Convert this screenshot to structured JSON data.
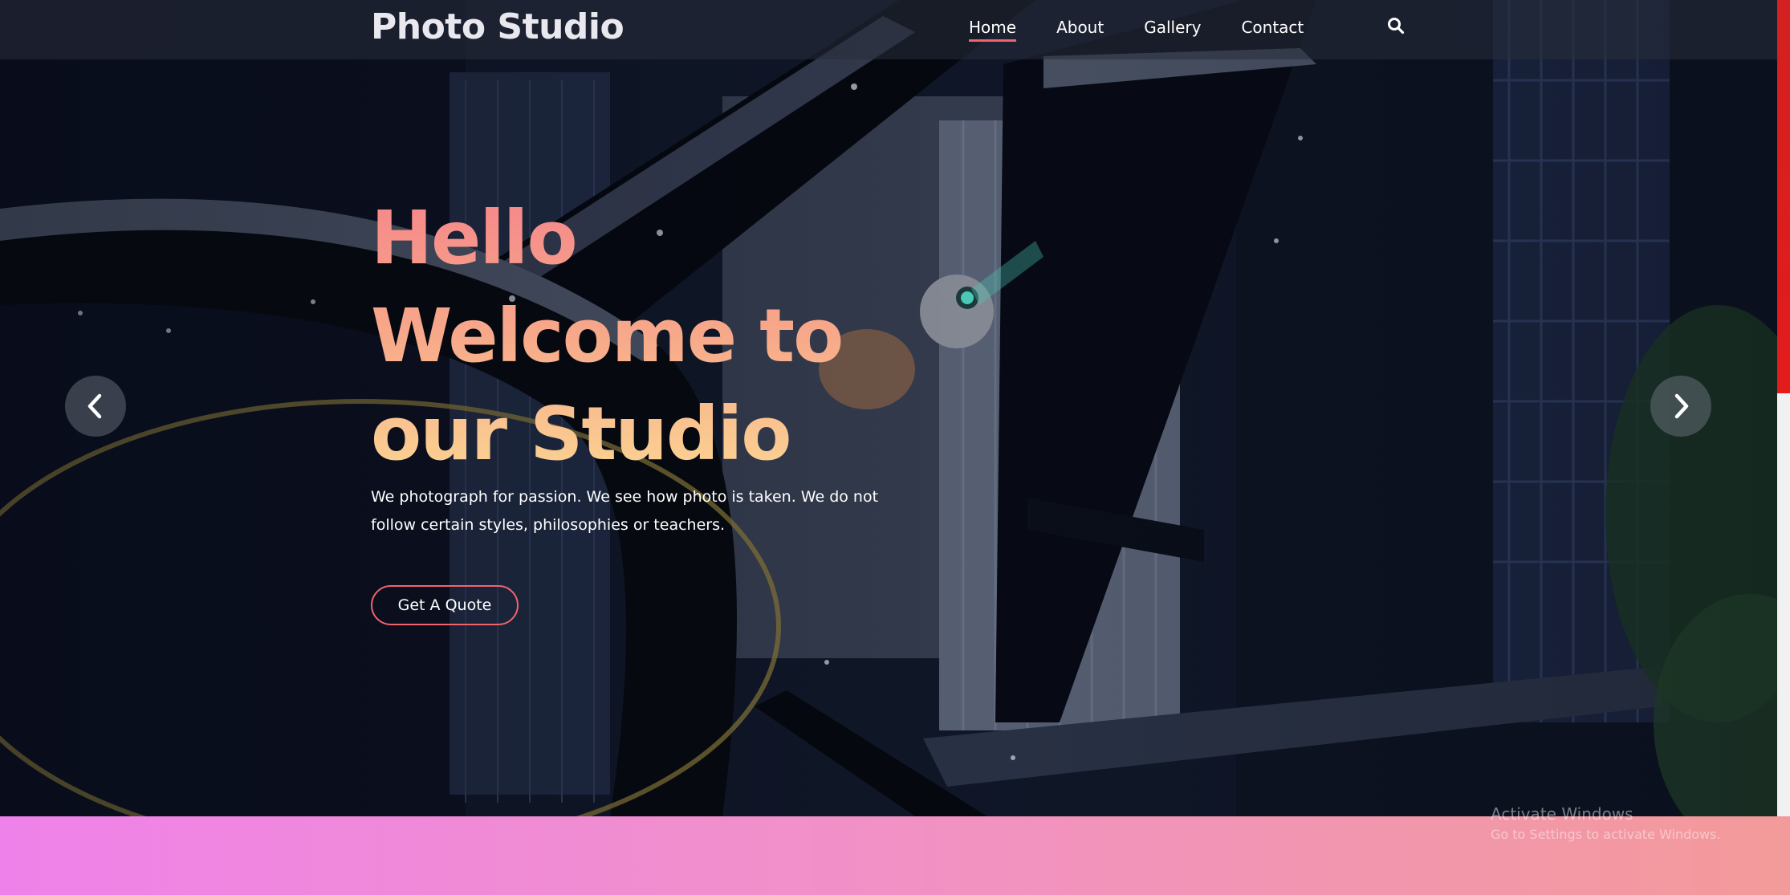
{
  "brand": "Photo Studio",
  "nav": {
    "items": [
      {
        "label": "Home",
        "active": true
      },
      {
        "label": "About",
        "active": false
      },
      {
        "label": "Gallery",
        "active": false
      },
      {
        "label": "Contact",
        "active": false
      }
    ],
    "search_icon": "search-icon"
  },
  "hero": {
    "headline": [
      "Hello",
      "Welcome to",
      "our Studio"
    ],
    "tagline": "We photograph for passion. We see how photo is taken. We do not follow certain styles, philosophies or teachers.",
    "cta_label": "Get A Quote",
    "prev_icon": "chevron-left-icon",
    "next_icon": "chevron-right-icon"
  },
  "watermark": {
    "line1": "Activate Windows",
    "line2": "Go to Settings to activate Windows."
  },
  "colors": {
    "accent": "#f0646e",
    "headline_top": "#f6868a",
    "headline_bottom": "#fbd593",
    "band_left": "#ef82ea",
    "band_right": "#f39a9a",
    "scrollbar_thumb": "#e31b1b"
  }
}
